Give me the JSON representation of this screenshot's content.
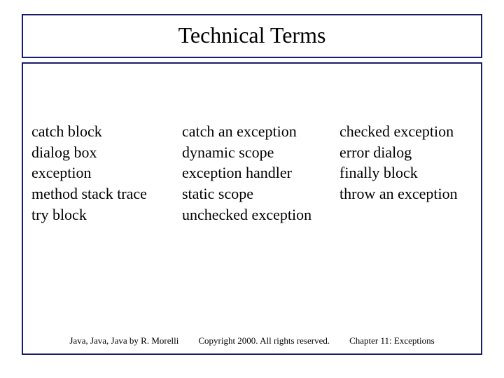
{
  "title": "Technical Terms",
  "columns": {
    "col1": {
      "t0": "catch block",
      "t1": "dialog box",
      "t2": "exception",
      "t3": "method stack trace",
      "t4": "try block"
    },
    "col2": {
      "t0": "catch an exception",
      "t1": "dynamic scope",
      "t2": "exception handler",
      "t3": "static scope",
      "t4": "unchecked exception"
    },
    "col3": {
      "t0": "checked exception",
      "t1": "error dialog",
      "t2": "finally block",
      "t3": "throw an exception"
    }
  },
  "footer": {
    "left": "Java, Java, Java by R. Morelli",
    "center": "Copyright 2000. All rights reserved.",
    "right": "Chapter 11: Exceptions"
  }
}
